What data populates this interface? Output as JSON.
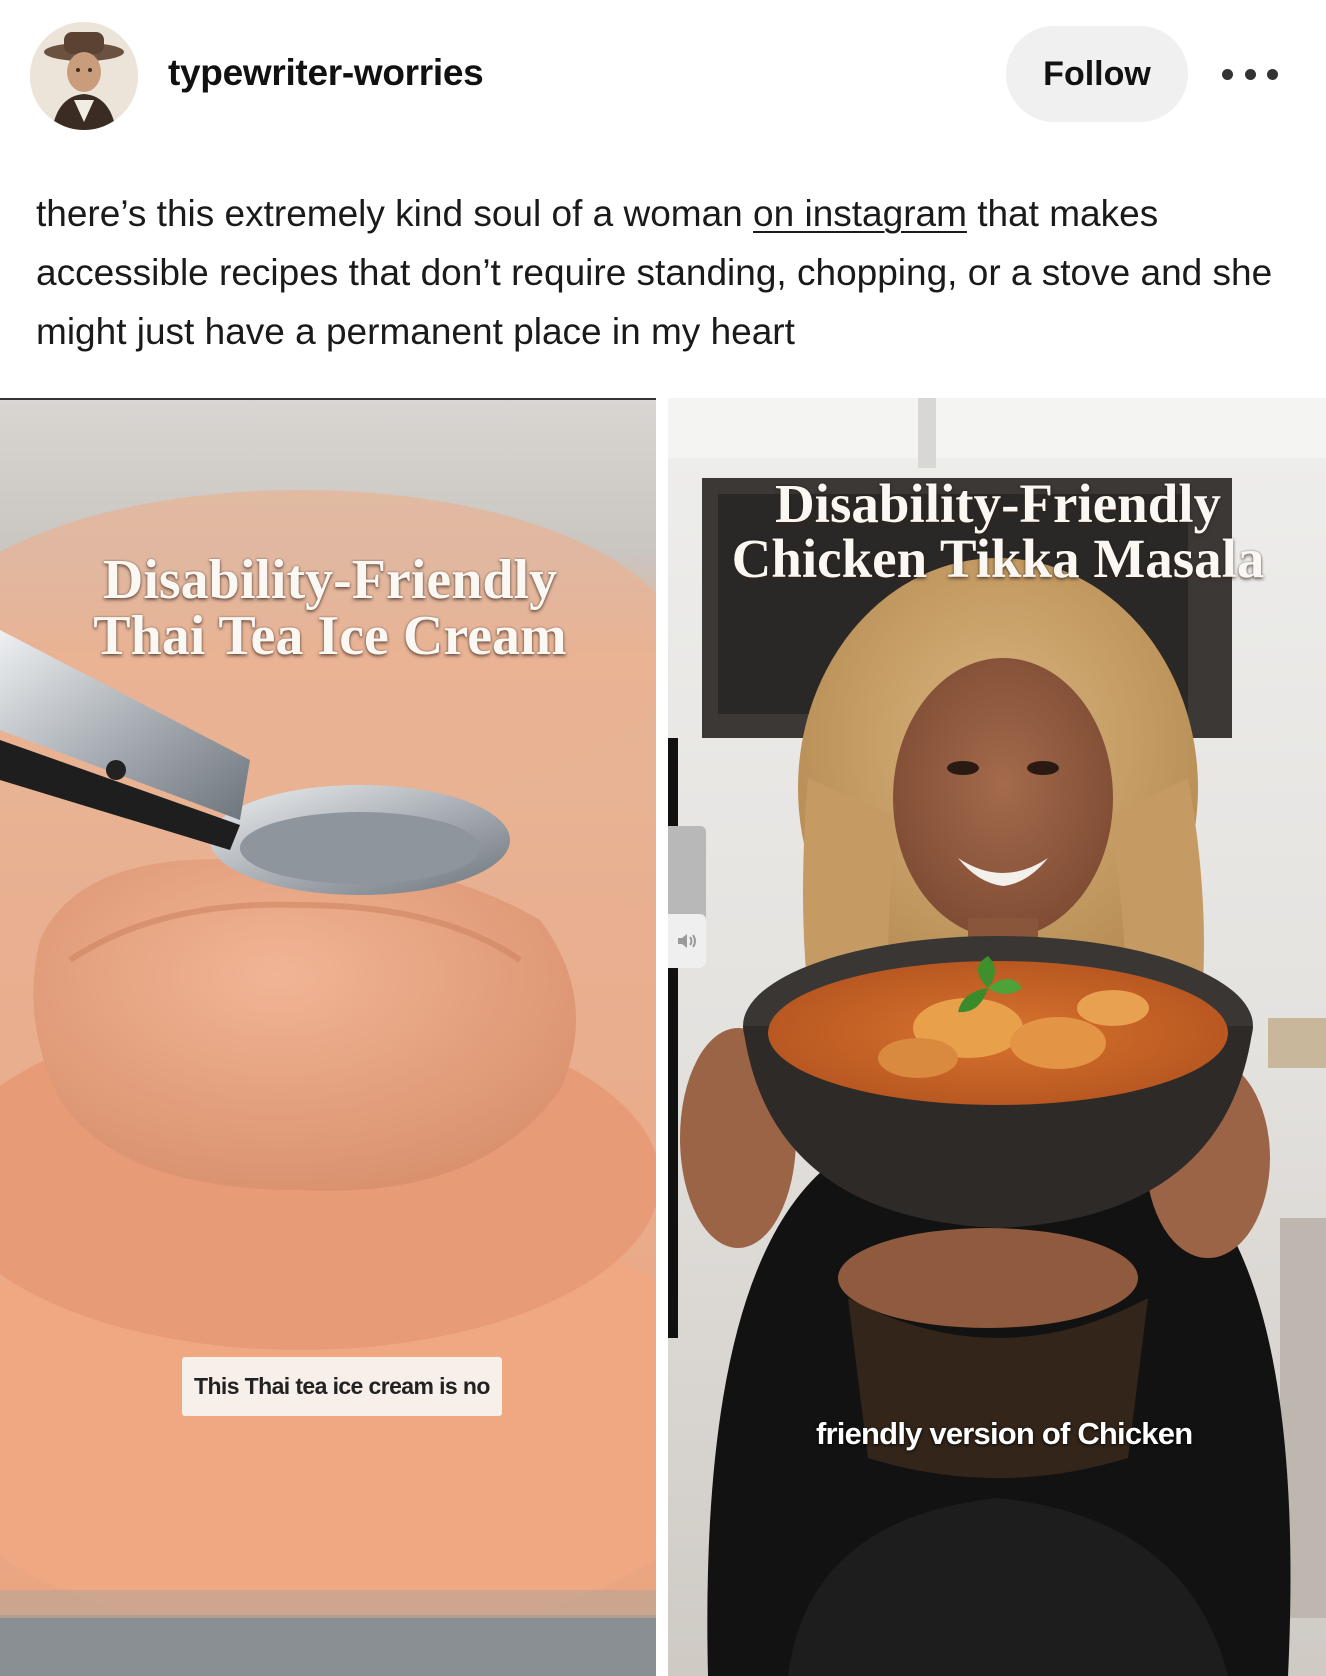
{
  "post": {
    "username": "typewriter-worries",
    "follow_label": "Follow",
    "body": {
      "text_before_link": "there’s this extremely kind soul of a woman ",
      "link_text": "on instagram",
      "text_after_link": " that makes accessible recipes that don’t require standing, chopping, or a stove and she might just have a permanent place in my heart"
    }
  },
  "media": [
    {
      "title_line1": "Disability-Friendly",
      "title_line2": "Thai Tea Ice Cream",
      "caption": "This Thai tea ice cream is no"
    },
    {
      "title_line1": "Disability-Friendly",
      "title_line2": "Chicken Tikka Masala",
      "caption": "friendly version of Chicken"
    }
  ],
  "icons": {
    "avatar": "avatar-portrait",
    "more": "more-dots-icon",
    "volume": "volume-icon"
  },
  "colors": {
    "follow_bg": "#f0f0f0",
    "text": "#1a1a1a",
    "ice_cream": "#e9a27e"
  }
}
